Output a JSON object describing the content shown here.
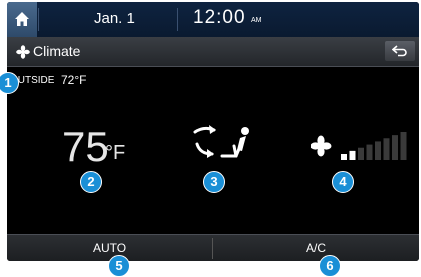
{
  "status_bar": {
    "date": "Jan.  1",
    "time": "12:00",
    "ampm": "AM",
    "home_icon": "home-icon"
  },
  "title_bar": {
    "title": "Climate",
    "title_icon": "fan-icon",
    "back_icon": "back-arrow-icon"
  },
  "outside": {
    "label": "OUTSIDE",
    "value": "72°F"
  },
  "temperature": {
    "value": "75",
    "unit": "°F"
  },
  "mode": {
    "icon": "airflow-mode-icon"
  },
  "fan": {
    "icon": "fan-icon",
    "level": 0.3,
    "total_bars": 8
  },
  "bottom_bar": {
    "auto_label": "AUTO",
    "ac_label": "A/C"
  },
  "callouts": [
    "1",
    "2",
    "3",
    "4",
    "5",
    "6"
  ],
  "colors": {
    "callout": "#1a8fd6",
    "status_bar": "#0e2340"
  }
}
